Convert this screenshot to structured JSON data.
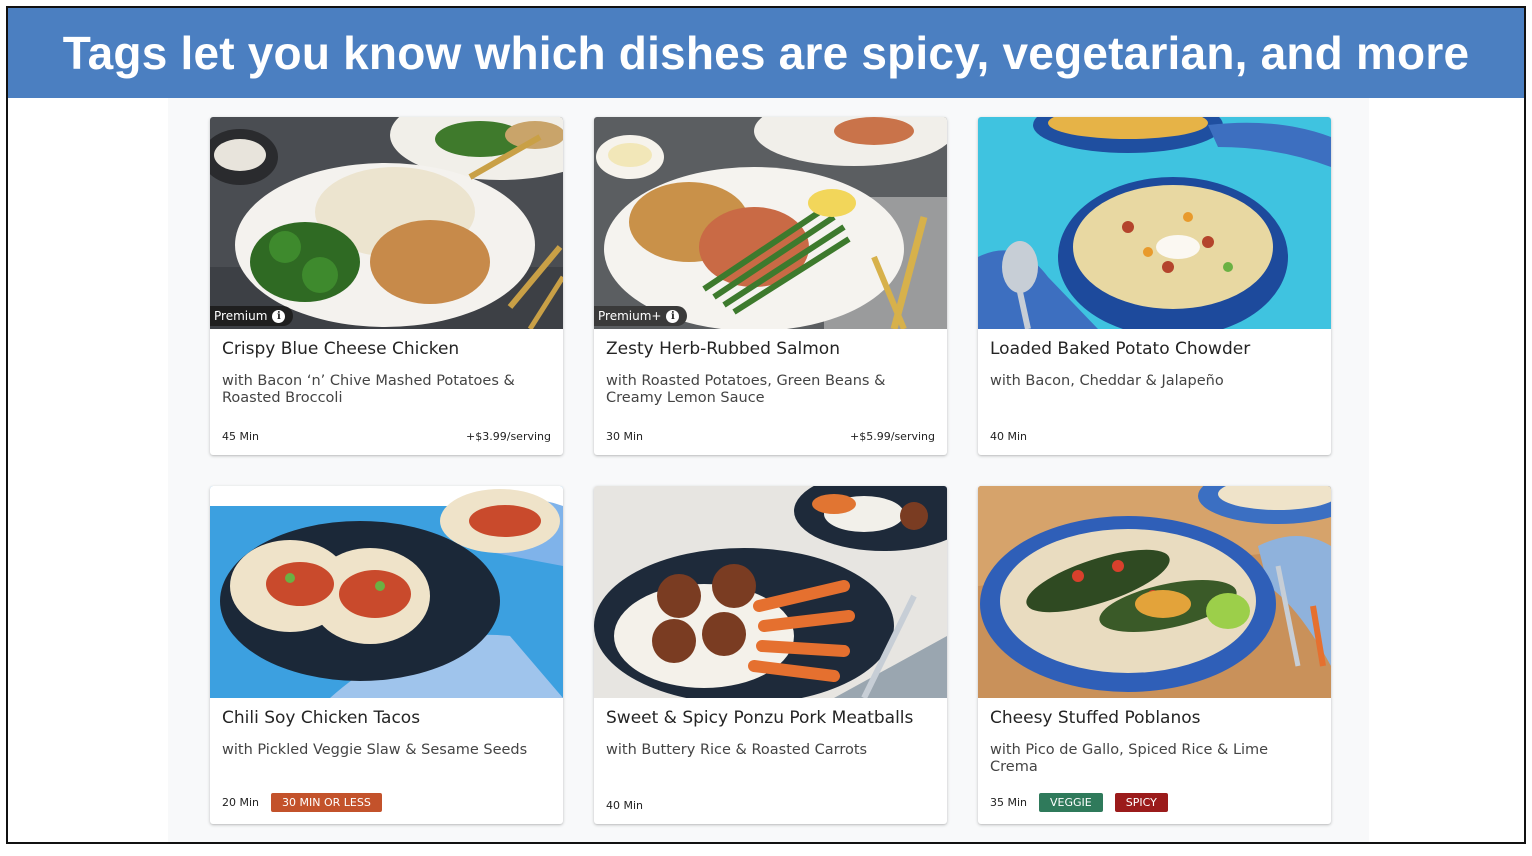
{
  "banner": {
    "title": "Tags let you know which dishes are spicy, vegetarian, and more"
  },
  "colors": {
    "banner": "#4b7fc1",
    "quick_tag": "#c3522b",
    "veggie_tag": "#2f7a5b",
    "spicy_tag": "#9b1b1b"
  },
  "cards": [
    {
      "title": "Crispy Blue Cheese Chicken",
      "subtitle": "with Bacon ‘n’ Chive Mashed Potatoes & Roasted Broccoli",
      "time": "45 Min",
      "price": "+$3.99/serving",
      "badge": "Premium",
      "info_icon": "i",
      "photo": "chicken-plate"
    },
    {
      "title": "Zesty Herb-Rubbed Salmon",
      "subtitle": "with Roasted Potatoes, Green Beans & Creamy Lemon Sauce",
      "time": "30 Min",
      "price": "+$5.99/serving",
      "badge": "Premium+",
      "info_icon": "i",
      "photo": "salmon-plate"
    },
    {
      "title": "Loaded Baked Potato Chowder",
      "subtitle": "with Bacon, Cheddar & Jalapeño",
      "time": "40 Min",
      "photo": "chowder-bowl"
    },
    {
      "title": "Chili Soy Chicken Tacos",
      "subtitle": "with Pickled Veggie Slaw & Sesame Seeds",
      "time": "20 Min",
      "tag": "30 MIN OR LESS",
      "photo": "tacos-plate"
    },
    {
      "title": "Sweet & Spicy Ponzu Pork Meatballs",
      "subtitle": "with Buttery Rice & Roasted Carrots",
      "time": "40 Min",
      "photo": "meatballs-plate"
    },
    {
      "title": "Cheesy Stuffed Poblanos",
      "subtitle": "with Pico de Gallo, Spiced Rice & Lime Crema",
      "time": "35 Min",
      "tags": [
        "VEGGIE",
        "SPICY"
      ],
      "photo": "poblanos-plate"
    }
  ]
}
